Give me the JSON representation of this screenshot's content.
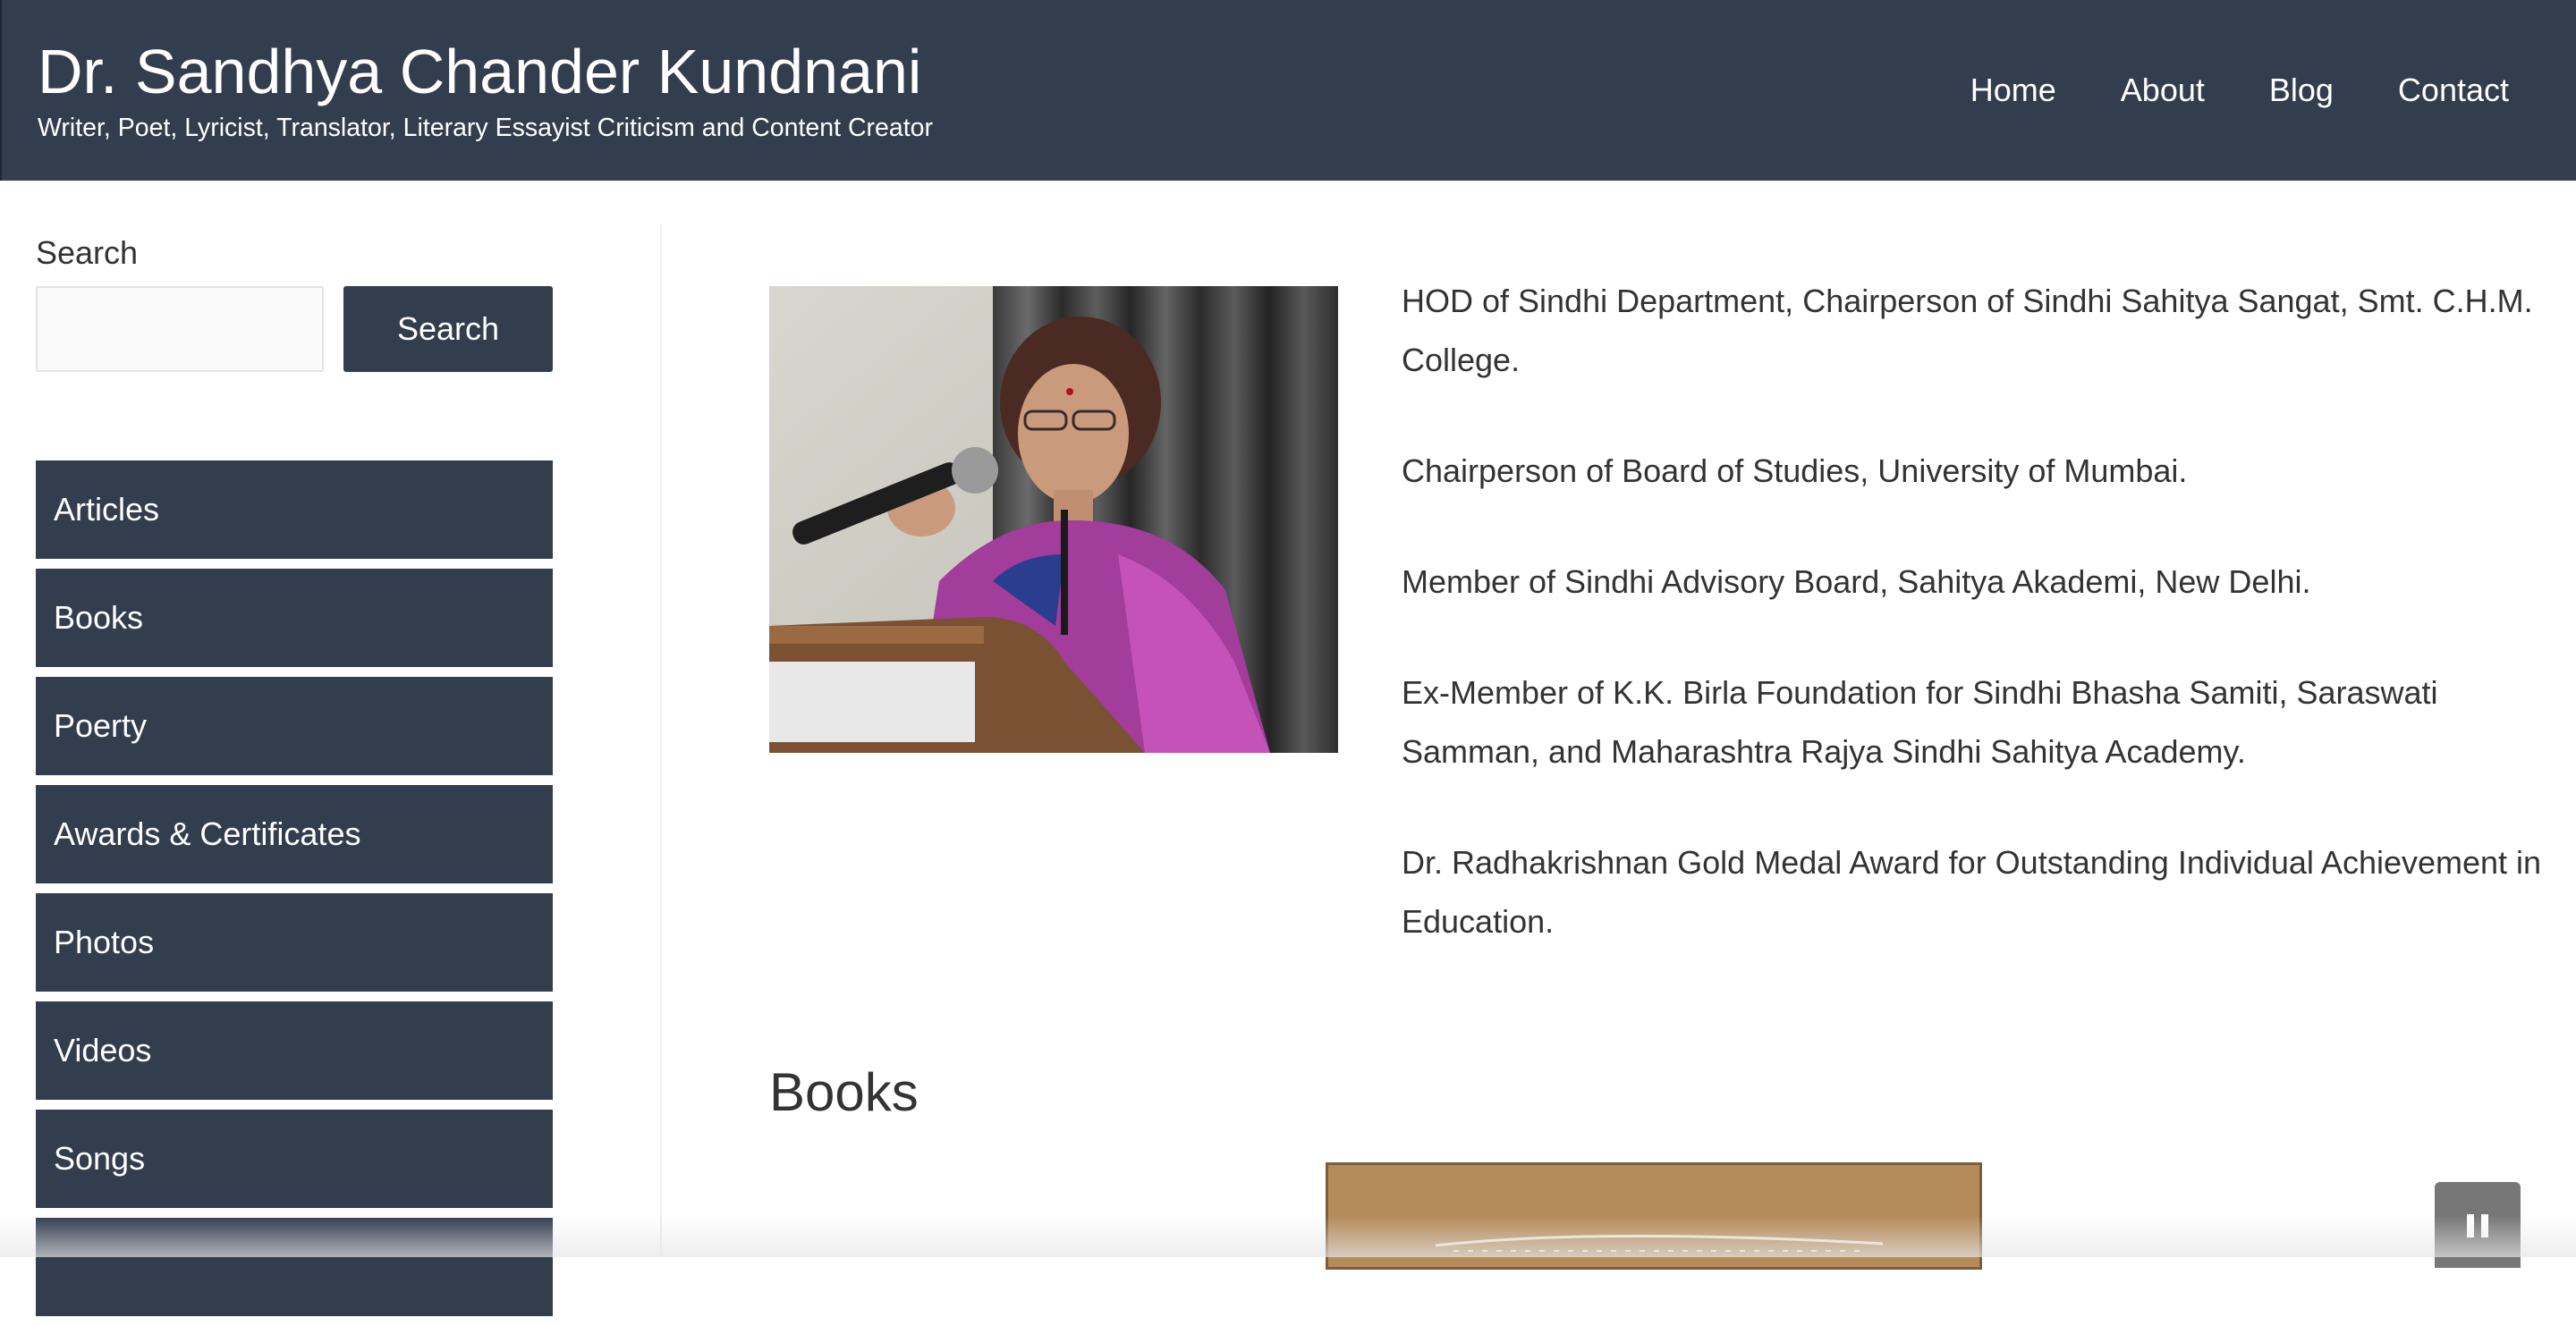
{
  "header": {
    "site_title": "Dr. Sandhya Chander Kundnani",
    "tagline": "Writer, Poet, Lyricist, Translator, Literary Essayist Criticism and Content Creator",
    "nav": [
      {
        "label": "Home"
      },
      {
        "label": "About"
      },
      {
        "label": "Blog"
      },
      {
        "label": "Contact"
      }
    ]
  },
  "sidebar": {
    "search_label": "Search",
    "search_placeholder": "",
    "search_button": "Search",
    "categories": [
      {
        "label": "Articles"
      },
      {
        "label": "Books"
      },
      {
        "label": "Poerty"
      },
      {
        "label": "Awards & Certificates"
      },
      {
        "label": "Photos"
      },
      {
        "label": "Videos"
      },
      {
        "label": "Songs"
      },
      {
        "label": ""
      }
    ]
  },
  "main": {
    "bio": [
      "HOD of Sindhi Department, Chairperson of Sindhi Sahitya Sangat, Smt. C.H.M. College.",
      "Chairperson of Board of Studies, University of Mumbai.",
      "Member of Sindhi Advisory Board, Sahitya Akademi, New Delhi.",
      "Ex-Member of K.K. Birla Foundation for Sindhi Bhasha Samiti, Saraswati Samman, and Maharashtra Rajya Sindhi Sahitya Academy.",
      "Dr. Radhakrishnan Gold Medal Award for Outstanding Individual Achievement in Education."
    ],
    "books_heading": "Books"
  },
  "colors": {
    "header_bg": "#323d4e",
    "button_bg": "#323d4e",
    "text": "#333333"
  },
  "icons": {
    "pause": "pause-icon"
  }
}
